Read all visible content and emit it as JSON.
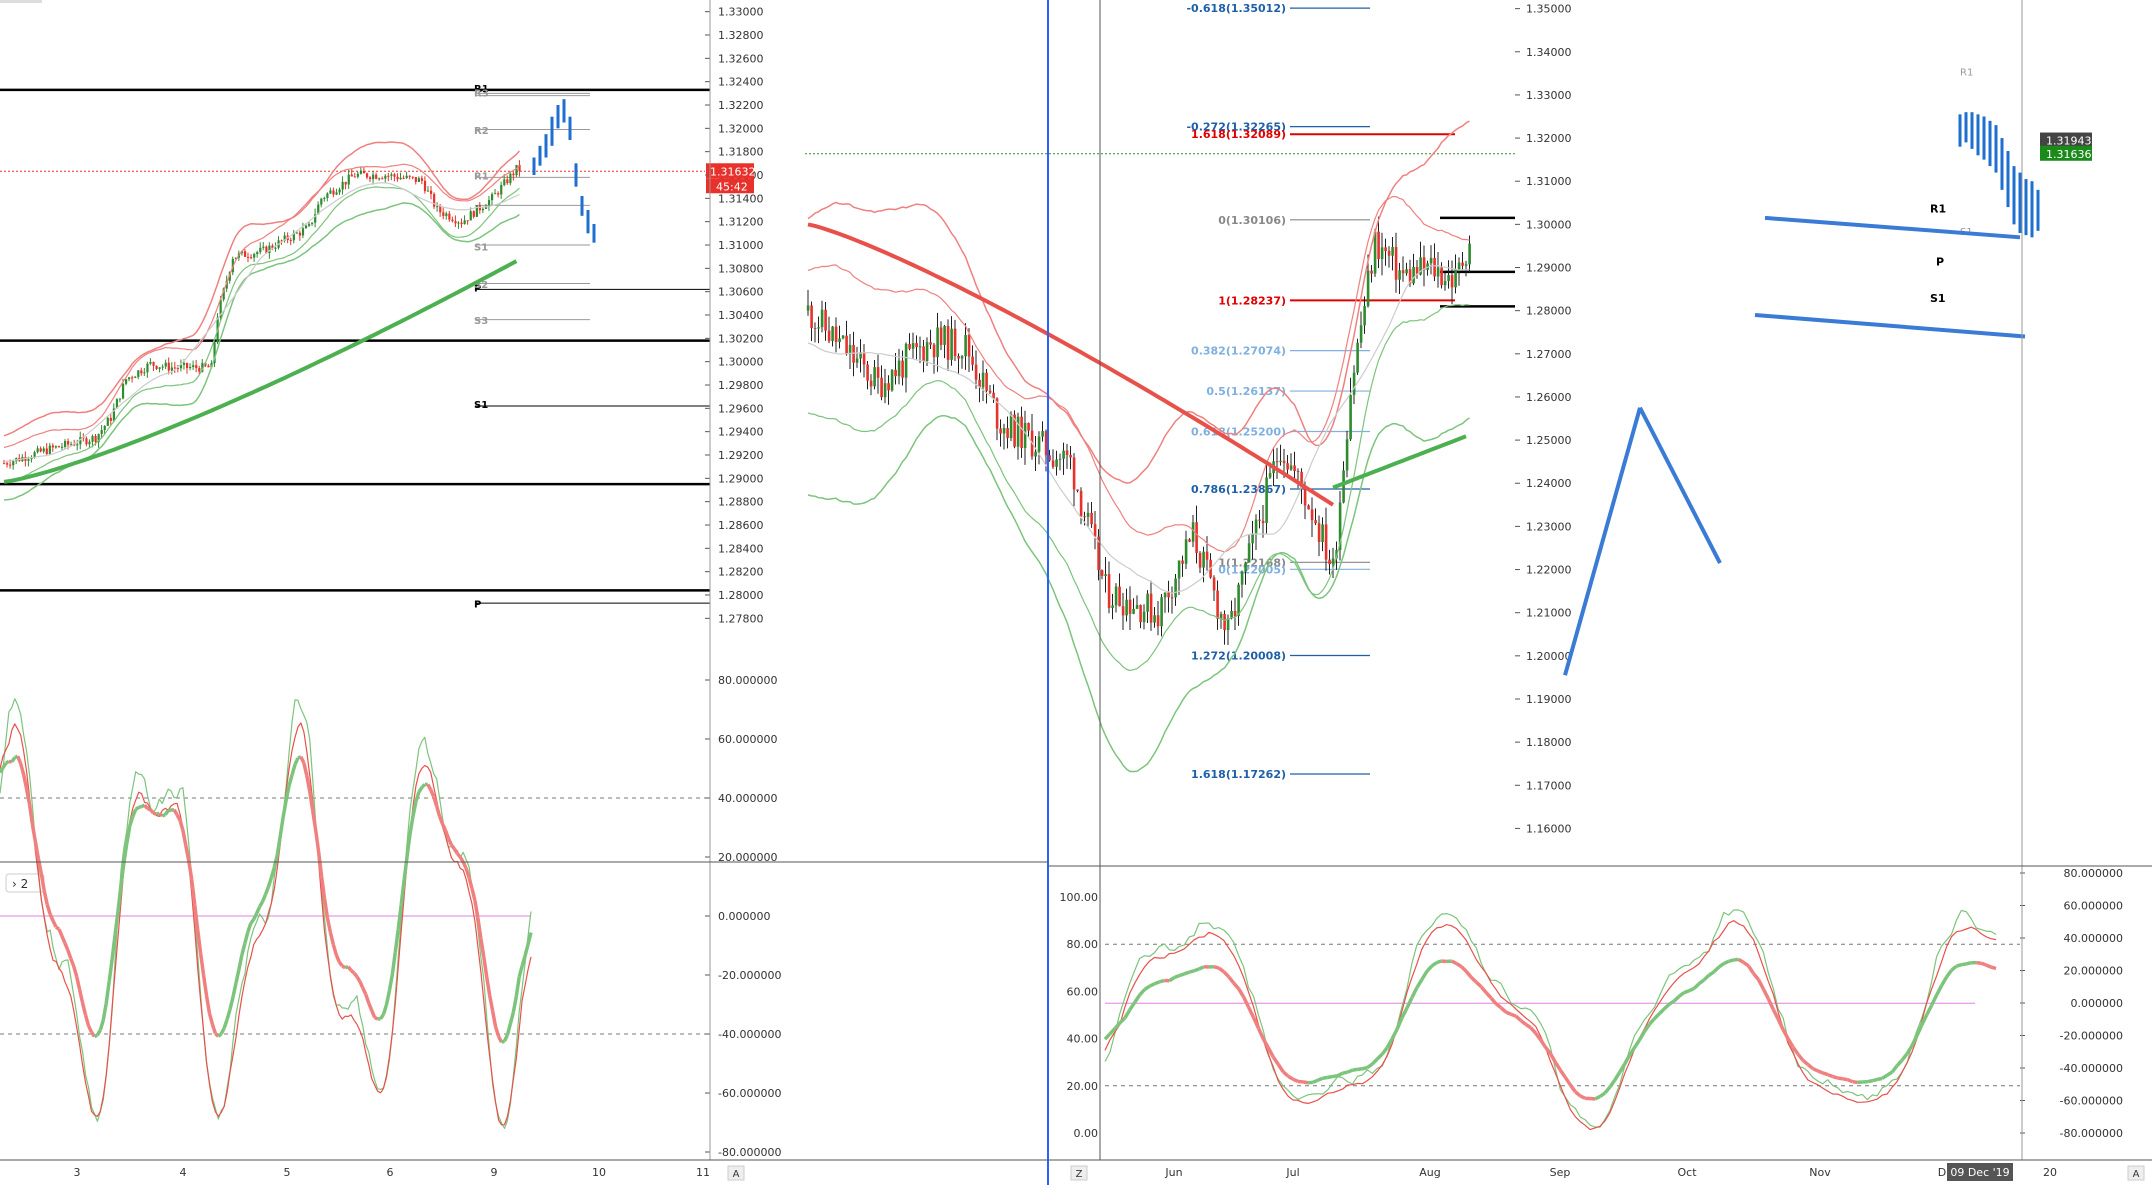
{
  "colors": {
    "up": "#2e8b2e",
    "down": "#e8312b",
    "bb_red": "#f08080",
    "bb_green": "#7cc47c",
    "ma_red": "#e8504a",
    "ma_green": "#4caf50",
    "ma_gray": "#cccccc",
    "projection": "#1e6fd0",
    "fib_red": "#e00000",
    "fib_blue": "#1f5fa8",
    "fib_light": "#7fb0e0",
    "divider": "#2962ff"
  },
  "left": {
    "price_axis": {
      "labels": [
        "1.33000",
        "1.32800",
        "1.32600",
        "1.32400",
        "1.32200",
        "1.32000",
        "1.31800",
        "1.31600",
        "1.31400",
        "1.31200",
        "1.31000",
        "1.30800",
        "1.30600",
        "1.30400",
        "1.30200",
        "1.30000",
        "1.29800",
        "1.29600",
        "1.29400",
        "1.29200",
        "1.29000",
        "1.28800",
        "1.28600",
        "1.28400",
        "1.28200",
        "1.28000",
        "1.27800"
      ],
      "min": 1.277,
      "max": 1.331
    },
    "time_axis": [
      "3",
      "4",
      "5",
      "6",
      "9",
      "10",
      "11"
    ],
    "corner_badge": "A",
    "current_price": "1.31632",
    "countdown": "45:42",
    "pivot_labels": [
      "R1",
      "R3",
      "R2",
      "R1",
      "P",
      "S1",
      "S2",
      "S3",
      "S1",
      "P",
      "S2"
    ],
    "osc_axis": [
      "80.000000",
      "60.000000",
      "40.000000",
      "20.000000",
      "0.000000",
      "-20.000000",
      "-40.000000",
      "-60.000000",
      "-80.000000"
    ],
    "osc_toggle": "2"
  },
  "right": {
    "price_axis": {
      "labels": [
        "1.35000",
        "1.34000",
        "1.33000",
        "1.32000",
        "1.31000",
        "1.30000",
        "1.29000",
        "1.28000",
        "1.27000",
        "1.26000",
        "1.25000",
        "1.24000",
        "1.23000",
        "1.22000",
        "1.21000",
        "1.20000",
        "1.19000",
        "1.18000",
        "1.17000",
        "1.16000"
      ],
      "min": 1.155,
      "max": 1.352
    },
    "time_axis": [
      "Jun",
      "Jul",
      "Aug",
      "Sep",
      "Oct",
      "Nov",
      "D",
      "20"
    ],
    "date_badge": "09 Dec '19",
    "corner_badges": [
      "Z",
      "A"
    ],
    "price_tag_high": "1.31943",
    "price_tag_current": "1.31636",
    "fib": [
      {
        "label": "-0.618(1.35012)",
        "value": 1.35012,
        "style": "blue"
      },
      {
        "label": "-0.272(1.32265)",
        "value": 1.32265,
        "style": "blue"
      },
      {
        "label": "1.618(1.32089)",
        "value": 1.32089,
        "style": "red"
      },
      {
        "label": "0(1.30106)",
        "value": 1.30106,
        "style": "gray"
      },
      {
        "label": "1(1.28237)",
        "value": 1.28237,
        "style": "red"
      },
      {
        "label": "0.382(1.27074)",
        "value": 1.27074,
        "style": "light"
      },
      {
        "label": "0.5(1.26137)",
        "value": 1.26137,
        "style": "light"
      },
      {
        "label": "0.618(1.25200)",
        "value": 1.252,
        "style": "light"
      },
      {
        "label": "0.786(1.23867)",
        "value": 1.23867,
        "style": "blue"
      },
      {
        "label": "1(1.22168)",
        "value": 1.22168,
        "style": "gray"
      },
      {
        "label": "0(1.22005)",
        "value": 1.22005,
        "style": "light"
      },
      {
        "label": "1.272(1.20008)",
        "value": 1.20008,
        "style": "blue"
      },
      {
        "label": "1.618(1.17262)",
        "value": 1.17262,
        "style": "blue"
      }
    ],
    "pivot_labels": [
      "R1",
      "R1",
      "P",
      "S1",
      "S1"
    ],
    "osc_left_axis": [
      "100.00",
      "80.00",
      "60.00",
      "40.00",
      "20.00",
      "0.00"
    ],
    "osc_right_axis": [
      "80.000000",
      "60.000000",
      "40.000000",
      "20.000000",
      "0.000000",
      "-20.000000",
      "-40.000000",
      "-60.000000",
      "-80.000000"
    ]
  }
}
